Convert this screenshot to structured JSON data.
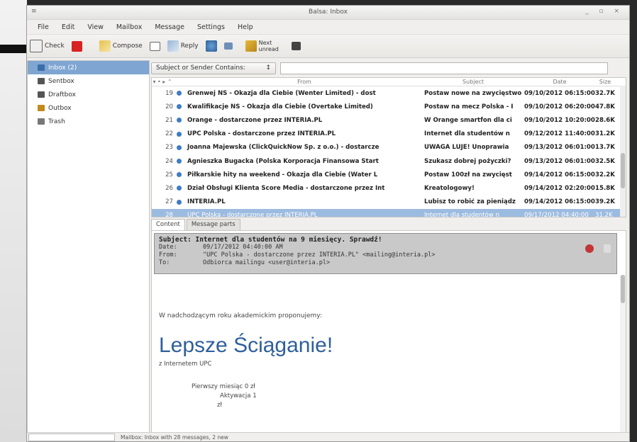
{
  "window": {
    "title": "Balsa: Inbox"
  },
  "menu": [
    "File",
    "Edit",
    "View",
    "Mailbox",
    "Message",
    "Settings",
    "Help"
  ],
  "toolbar": {
    "check": "Check",
    "compose": "Compose",
    "reply": "Reply",
    "next_line1": "Next",
    "next_line2": "unread"
  },
  "folders": [
    {
      "label": "Inbox (2)",
      "icon": "inbox-icon",
      "color": "#3c6ea8"
    },
    {
      "label": "Sentbox",
      "icon": "sentbox-icon",
      "color": "#555555"
    },
    {
      "label": "Draftbox",
      "icon": "draftbox-icon",
      "color": "#555555"
    },
    {
      "label": "Outbox",
      "icon": "outbox-icon",
      "color": "#c28a1c"
    },
    {
      "label": "Trash",
      "icon": "trash-icon",
      "color": "#777777"
    }
  ],
  "search": {
    "field_label": "Subject or Sender Contains:",
    "value": ""
  },
  "columns": {
    "from": "From",
    "subject": "Subject",
    "date": "Date",
    "size": "Size"
  },
  "messages": [
    {
      "num": "19",
      "from": "Grenwej NS - Okazja dla Ciebie (Wenter Limited) - dost",
      "subject": "Postaw nowe na zwycięstwo",
      "date": "09/10/2012 06:15:00",
      "size": "32.7K",
      "selected": false
    },
    {
      "num": "20",
      "from": "Kwalifikacje NS - Okazja dla Ciebie (Overtake Limited)",
      "subject": "Postaw na mecz Polska - I",
      "date": "09/10/2012 06:20:00",
      "size": "47.8K",
      "selected": false
    },
    {
      "num": "21",
      "from": "Orange - dostarczone przez INTERIA.PL",
      "subject": "W Orange smartfon dla ci",
      "date": "09/10/2012 10:20:00",
      "size": "28.6K",
      "selected": false
    },
    {
      "num": "22",
      "from": "UPC Polska - dostarczone przez INTERIA.PL",
      "subject": "Internet dla studentów n",
      "date": "09/12/2012 11:40:00",
      "size": "31.2K",
      "selected": false
    },
    {
      "num": "23",
      "from": "Joanna Majewska (ClickQuickNow Sp. z o.o.) - dostarcze",
      "subject": "UWAGA LUJE! Unoprawia",
      "date": "09/13/2012 06:01:00",
      "size": "13.7K",
      "selected": false
    },
    {
      "num": "24",
      "from": "Agnieszka Bugacka (Polska Korporacja Finansowa Start",
      "subject": "Szukasz dobrej pożyczki?",
      "date": "09/13/2012 06:01:00",
      "size": "32.5K",
      "selected": false
    },
    {
      "num": "25",
      "from": "Piłkarskie hity na weekend - Okazja dla Ciebie (Water L",
      "subject": "Postaw 100zł na zwycięst",
      "date": "09/14/2012 06:15:00",
      "size": "32.2K",
      "selected": false
    },
    {
      "num": "26",
      "from": "Dział Obsługi Klienta Score Media - dostarczone przez Int",
      "subject": "Kreatologowy!",
      "date": "09/14/2012 02:20:00",
      "size": "15.8K",
      "selected": false
    },
    {
      "num": "27",
      "from": "INTERIA.PL",
      "subject": "Lubisz to robić za pieniądz",
      "date": "09/14/2012 06:15:00",
      "size": "39.2K",
      "selected": false
    },
    {
      "num": "28",
      "from": "UPC Polska - dostarczone przez INTERIA.PL",
      "subject": "Internet dla studentów n",
      "date": "09/17/2012 04:40:00",
      "size": "31.2K",
      "selected": true
    }
  ],
  "tabs": [
    "Content",
    "Message parts"
  ],
  "header": {
    "subject": "Subject: Internet dla studentów na 9 miesięcy. Sprawdź!",
    "date_key": "Date:",
    "date_val": "09/17/2012 04:40:00 AM",
    "from_key": "From:",
    "from_val": "\"UPC Polska - dostarczone przez INTERIA.PL\" <mailing@interia.pl>",
    "to_key": "To:",
    "to_val": "Odbiorca mailingu <user@interia.pl>"
  },
  "body": {
    "intro": "W nadchodzącym roku akademickim proponujemy:",
    "hero": "Lepsze Ściąganie!",
    "sub": "z Internetem UPC",
    "line1": "Pierwszy miesiąc 0 zł",
    "line2": "Aktywacja 1",
    "line3": "zł"
  },
  "status": {
    "text": "Mailbox: Inbox with 28 messages, 2 new"
  }
}
